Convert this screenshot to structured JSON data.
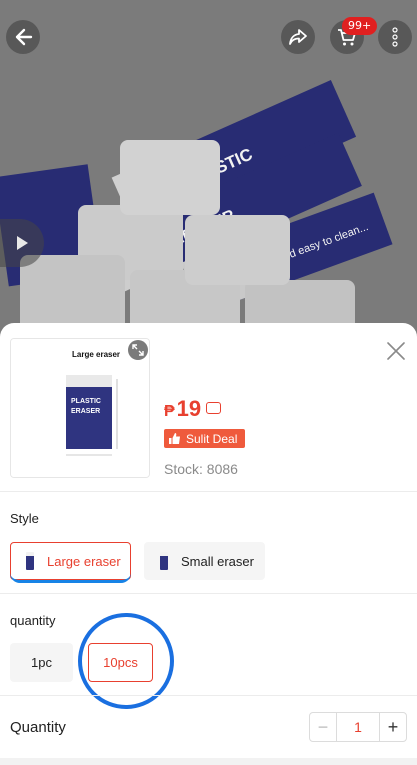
{
  "header": {
    "cart_badge": "99+",
    "icons": [
      "back-arrow-icon",
      "share-icon",
      "cart-icon",
      "more-icon",
      "play-icon"
    ]
  },
  "hero_image": {
    "product_text": [
      "PLASTIC",
      "ERASER",
      "Soft and easy to clean..."
    ]
  },
  "sheet": {
    "thumbnail_caption": "Large eraser",
    "price_currency": "₱",
    "price_amount": "19",
    "deal_label": "Sulit Deal",
    "stock_text": "Stock: 8086",
    "style_label": "Style",
    "style_options": [
      {
        "label": "Large eraser",
        "selected": true
      },
      {
        "label": "Small eraser",
        "selected": false
      }
    ],
    "quantity_pack_label": "quantity",
    "quantity_pack_options": [
      {
        "label": "1pc",
        "selected": false
      },
      {
        "label": "10pcs",
        "selected": true
      }
    ],
    "quantity_title": "Quantity",
    "quantity_value": "1",
    "stepper_minus": "−",
    "stepper_plus": "+"
  },
  "colors": {
    "accent": "#e8402f",
    "highlight_ring": "#1a6fe0",
    "eraser_sleeve": "#2f3480"
  }
}
